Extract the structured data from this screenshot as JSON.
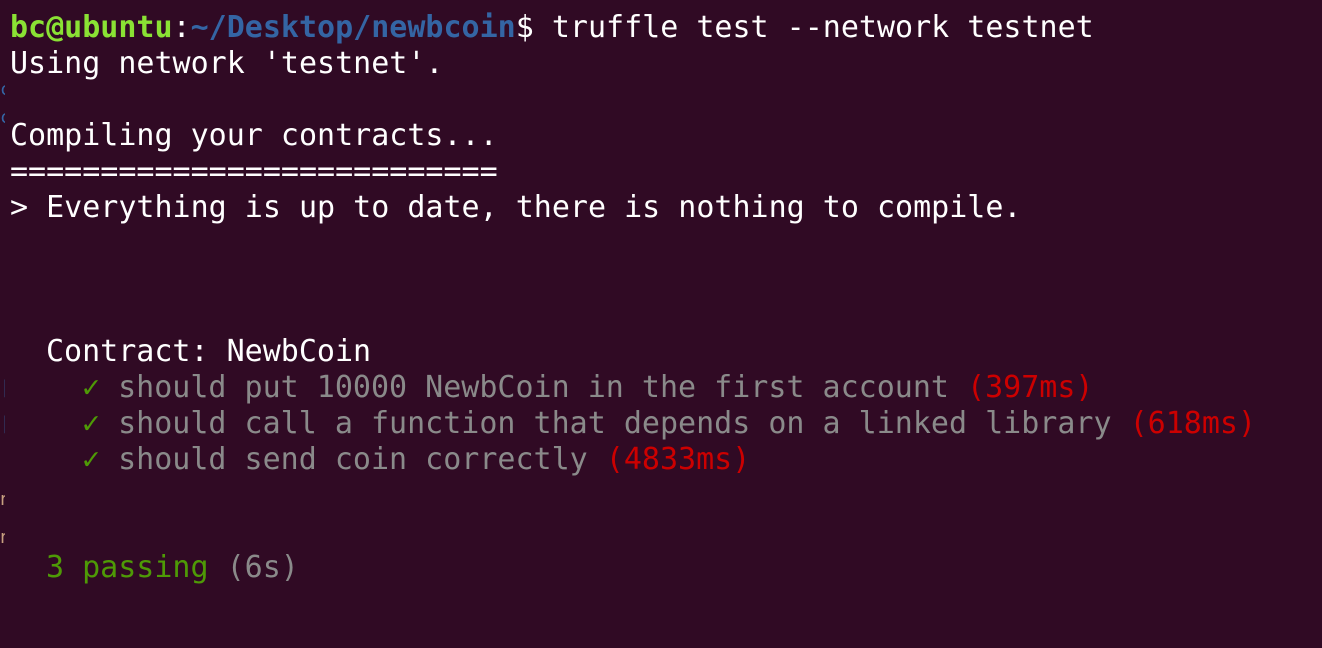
{
  "prompt": {
    "user": "bc@ubuntu",
    "separator": ":",
    "path": "~/Desktop/newbcoin",
    "symbol": "$",
    "command": " truffle test --network testnet"
  },
  "output": {
    "using_network": "Using network 'testnet'.",
    "compiling": "Compiling your contracts...",
    "separator_line": "===========================",
    "up_to_date": "> Everything is up to date, there is nothing to compile.",
    "contract_header": "Contract: NewbCoin",
    "tests": [
      {
        "check": "✓",
        "name": " should put 10000 NewbCoin in the first account",
        "duration": " (397ms)"
      },
      {
        "check": "✓",
        "name": " should call a function that depends on a linked library",
        "duration": " (618ms)"
      },
      {
        "check": "✓",
        "name": " should send coin correctly",
        "duration": " (4833ms)"
      }
    ],
    "summary": {
      "passing": "3 passing",
      "time": " (6s)"
    }
  },
  "colors": {
    "background": "#300a24",
    "prompt_user": "#8ae234",
    "prompt_path": "#3465a4",
    "pass_green": "#4e9a06",
    "slow_red": "#cc0000",
    "test_gray": "#8a8a8a"
  }
}
